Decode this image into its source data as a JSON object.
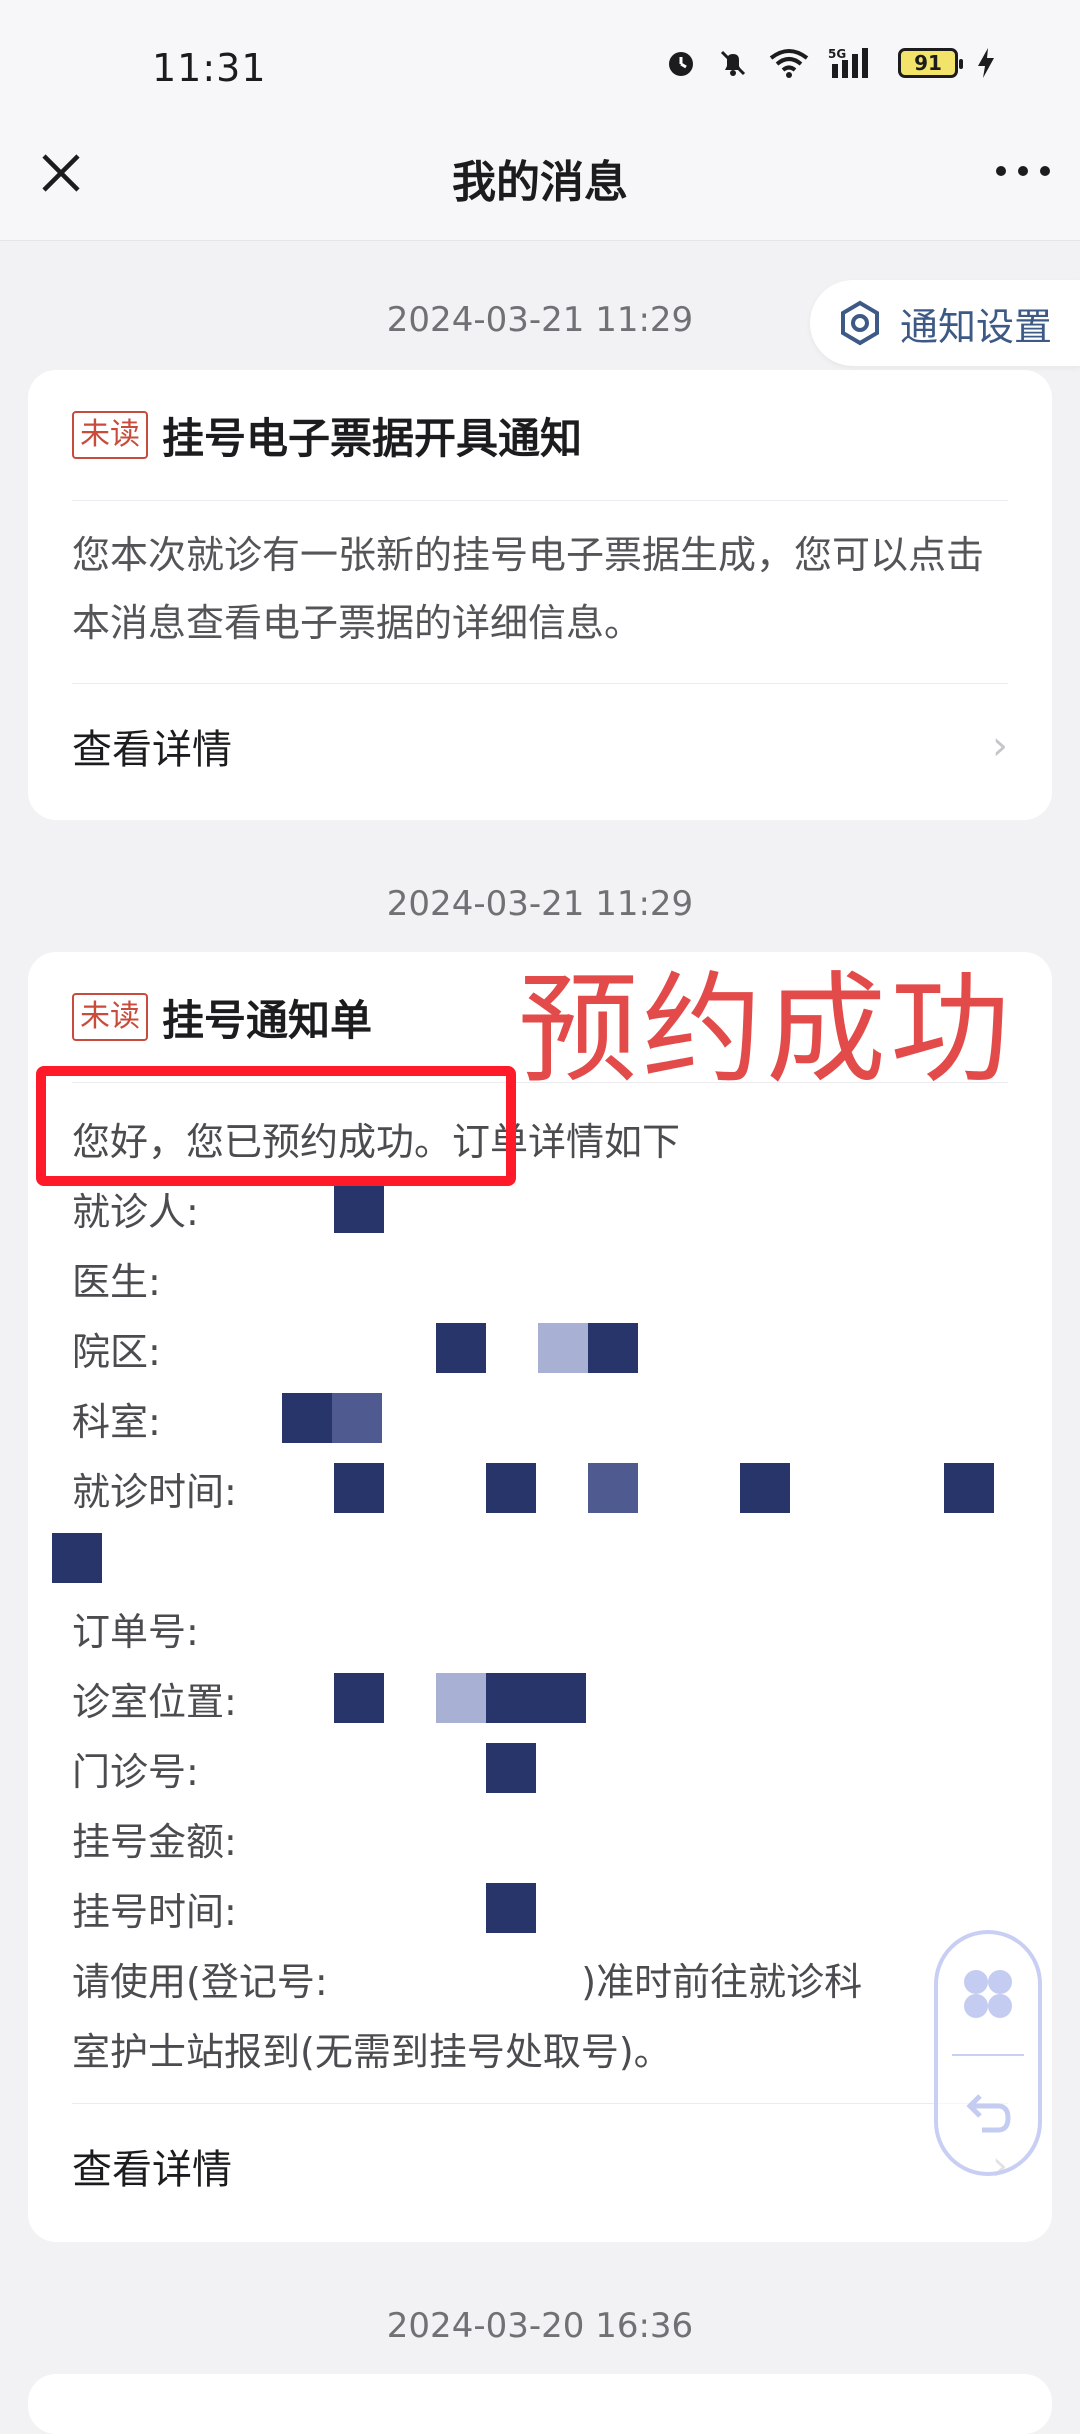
{
  "status_bar": {
    "time": "11:31",
    "battery": "91",
    "icons": [
      "alarm-icon",
      "mute-bell-icon",
      "wifi-icon",
      "5g-signal-icon",
      "battery-icon",
      "charging-icon"
    ]
  },
  "nav": {
    "title": "我的消息",
    "close_icon": "close-icon",
    "more_icon": "more-icon"
  },
  "settings": {
    "label": "通知设置",
    "icon": "gear-icon"
  },
  "messages": [
    {
      "date": "2024-03-21 11:29",
      "badge": "未读",
      "title": "挂号电子票据开具通知",
      "body": "您本次就诊有一张新的挂号电子票据生成，您可以点击本消息查看电子票据的详细信息。",
      "action": "查看详情"
    },
    {
      "date": "2024-03-21 11:29",
      "badge": "未读",
      "title": "挂号通知单",
      "intro": "您好，您已预约成功。订单详情如下",
      "fields": [
        "就诊人:",
        "医生:",
        "院区:",
        "科室:",
        "就诊时间:",
        "订单号:",
        "诊室位置:",
        "门诊号:",
        "挂号金额:",
        "挂号时间:"
      ],
      "notice_line1": "请使用(登记号:                     )准时前往就诊科",
      "notice_line2": "室护士站报到(无需到挂号处取号)。",
      "action": "查看详情"
    },
    {
      "date": "2024-03-20 16:36"
    }
  ],
  "annotation": {
    "watermark": "预约成功",
    "color": "#ff1a2a"
  },
  "float_widget": {
    "icons": [
      "apps-icon",
      "back-arrow-icon"
    ]
  }
}
